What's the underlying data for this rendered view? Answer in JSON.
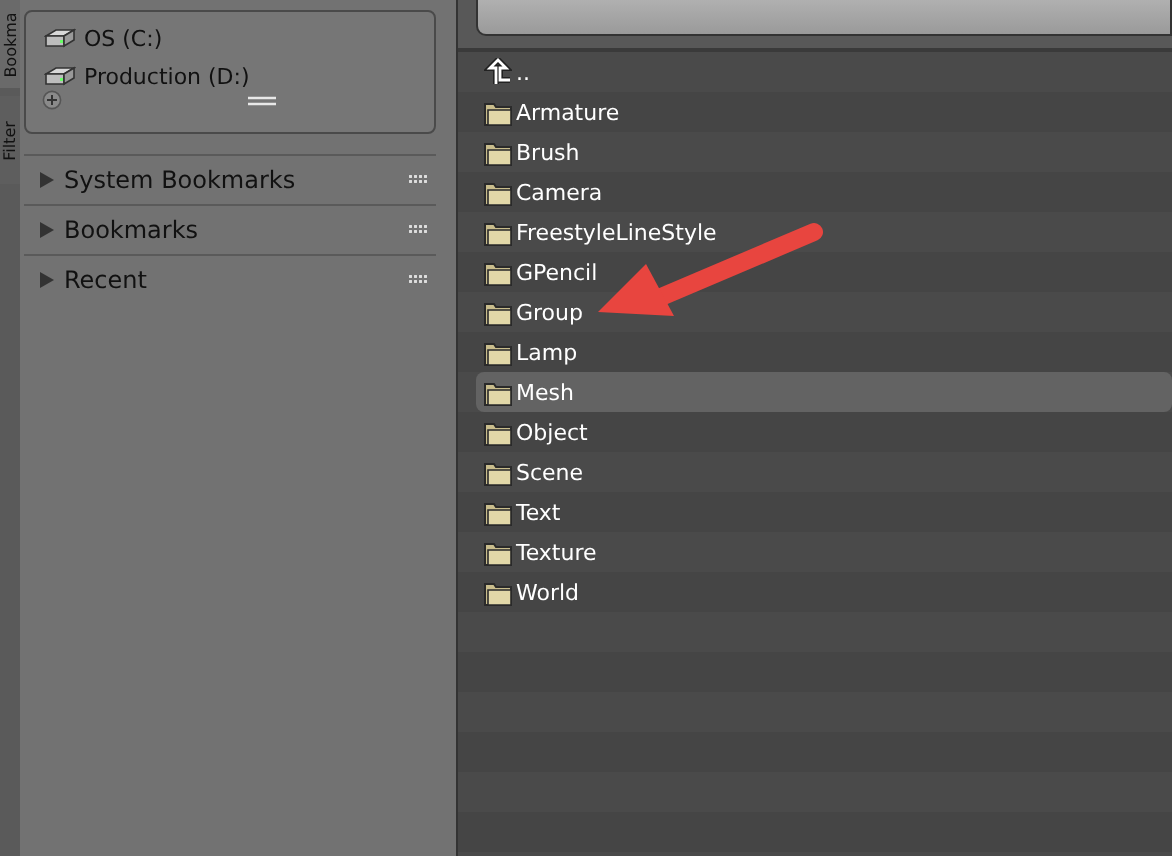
{
  "side_tabs": [
    {
      "label": "Bookma"
    },
    {
      "label": "Filter"
    }
  ],
  "drives": [
    {
      "label": "OS (C:)"
    },
    {
      "label": "Production (D:)"
    }
  ],
  "sections": [
    {
      "label": "System Bookmarks",
      "expanded": false
    },
    {
      "label": "Bookmarks",
      "expanded": false
    },
    {
      "label": "Recent",
      "expanded": false
    }
  ],
  "files": [
    {
      "name": "..",
      "kind": "parent",
      "selected": false
    },
    {
      "name": "Armature",
      "kind": "folder",
      "selected": false
    },
    {
      "name": "Brush",
      "kind": "folder",
      "selected": false
    },
    {
      "name": "Camera",
      "kind": "folder",
      "selected": false
    },
    {
      "name": "FreestyleLineStyle",
      "kind": "folder",
      "selected": false
    },
    {
      "name": "GPencil",
      "kind": "folder",
      "selected": false
    },
    {
      "name": "Group",
      "kind": "folder",
      "selected": false
    },
    {
      "name": "Lamp",
      "kind": "folder",
      "selected": false
    },
    {
      "name": "Mesh",
      "kind": "folder",
      "selected": true
    },
    {
      "name": "Object",
      "kind": "folder",
      "selected": false
    },
    {
      "name": "Scene",
      "kind": "folder",
      "selected": false
    },
    {
      "name": "Text",
      "kind": "folder",
      "selected": false
    },
    {
      "name": "Texture",
      "kind": "folder",
      "selected": false
    },
    {
      "name": "World",
      "kind": "folder",
      "selected": false
    }
  ]
}
